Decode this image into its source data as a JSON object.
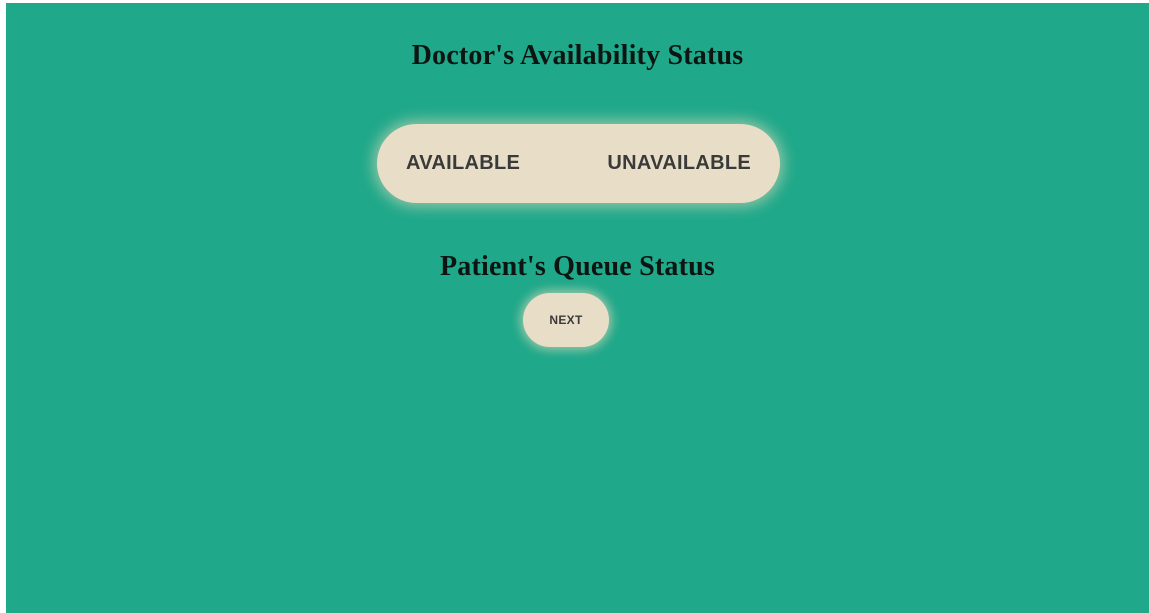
{
  "doctor_section": {
    "title": "Doctor's Availability Status",
    "available_label": "AVAILABLE",
    "unavailable_label": "UNAVAILABLE"
  },
  "queue_section": {
    "title": "Patient's Queue Status",
    "next_label": "NEXT"
  },
  "colors": {
    "background": "#1fa88a",
    "button_fill": "#e8dec7",
    "heading_text": "#0d1512",
    "button_text": "#3a3a3a"
  }
}
